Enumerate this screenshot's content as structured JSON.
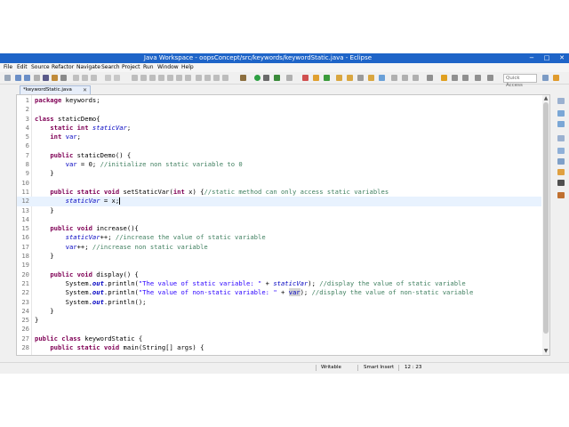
{
  "window": {
    "title": "Java Workspace - oopsConcept/src/keywords/keywordStatic.java - Eclipse",
    "minimize_glyph": "−",
    "maximize_glyph": "□",
    "close_glyph": "✕"
  },
  "menu": {
    "items": [
      "File",
      "Edit",
      "Source",
      "Refactor",
      "Navigate",
      "Search",
      "Project",
      "Run",
      "Window",
      "Help"
    ]
  },
  "toolbar": {
    "quick_access_placeholder": "Quick Access"
  },
  "editor_tab": {
    "label": "*keywordStatic.java",
    "close_glyph": "✕"
  },
  "code": {
    "current_line": 12,
    "lines": [
      {
        "n": "1",
        "html": "<span class=\"kw\">package</span> keywords;"
      },
      {
        "n": "2",
        "html": ""
      },
      {
        "n": "3",
        "html": "<span class=\"kw\">class</span> staticDemo{"
      },
      {
        "n": "4",
        "html": "    <span class=\"kw\">static</span> <span class=\"kw\">int</span> <span class=\"fld\">staticVar</span>;"
      },
      {
        "n": "5",
        "html": "    <span class=\"kw\">int</span> <span class=\"inst\">var</span>;"
      },
      {
        "n": "6",
        "html": ""
      },
      {
        "n": "7",
        "html": "    <span class=\"kw\">public</span> staticDemo() {"
      },
      {
        "n": "8",
        "html": "        <span class=\"inst\">var</span> = 0; <span class=\"cm\">//initialize non static variable to 0</span>"
      },
      {
        "n": "9",
        "html": "    }"
      },
      {
        "n": "10",
        "html": ""
      },
      {
        "n": "11",
        "html": "    <span class=\"kw\">public</span> <span class=\"kw\">static</span> <span class=\"kw\">void</span> setStaticVar(<span class=\"kw\">int</span> x) {<span class=\"cm\">//static method can only access static variables</span>"
      },
      {
        "n": "12",
        "html": "        <span class=\"fld\">staticVar</span> = x;<span class=\"cursor\"></span>"
      },
      {
        "n": "13",
        "html": "    }"
      },
      {
        "n": "14",
        "html": ""
      },
      {
        "n": "15",
        "html": "    <span class=\"kw\">public</span> <span class=\"kw\">void</span> increase(){"
      },
      {
        "n": "16",
        "html": "        <span class=\"fld\">staticVar</span>++; <span class=\"cm\">//increase the value of static variable</span>"
      },
      {
        "n": "17",
        "html": "        <span class=\"inst\">var</span>++; <span class=\"cm\">//increase non static variable</span>"
      },
      {
        "n": "18",
        "html": "    }"
      },
      {
        "n": "19",
        "html": ""
      },
      {
        "n": "20",
        "html": "    <span class=\"kw\">public</span> <span class=\"kw\">void</span> display() {"
      },
      {
        "n": "21",
        "html": "        System.<span class=\"fldb\">out</span>.println(<span class=\"str\">\"The value of static variable: \"</span> + <span class=\"fld\">staticVar</span>); <span class=\"cm\">//display the value of static variable</span>"
      },
      {
        "n": "22",
        "html": "        System.<span class=\"fldb\">out</span>.println(<span class=\"str\">\"The value of non-static variable: \"</span> + <span class=\"inst hl\">var</span>); <span class=\"cm\">//display the value of non-static variable</span>"
      },
      {
        "n": "23",
        "html": "        System.<span class=\"fldb\">out</span>.println();"
      },
      {
        "n": "24",
        "html": "    }"
      },
      {
        "n": "25",
        "html": "}"
      },
      {
        "n": "26",
        "html": ""
      },
      {
        "n": "27",
        "html": "<span class=\"kw\">public</span> <span class=\"kw\">class</span> keywordStatic {"
      },
      {
        "n": "28",
        "html": "    <span class=\"kw\">public</span> <span class=\"kw\">static</span> <span class=\"kw\">void</span> main(String[] args) {"
      }
    ]
  },
  "status": {
    "writable": "Writable",
    "insert_mode": "Smart Insert",
    "position": "12 : 23"
  },
  "colors": {
    "title_bar": "#1e64c8",
    "keyword": "#7f0055",
    "field": "#0000c0",
    "comment": "#3f7f5f",
    "string": "#2a00ff"
  }
}
